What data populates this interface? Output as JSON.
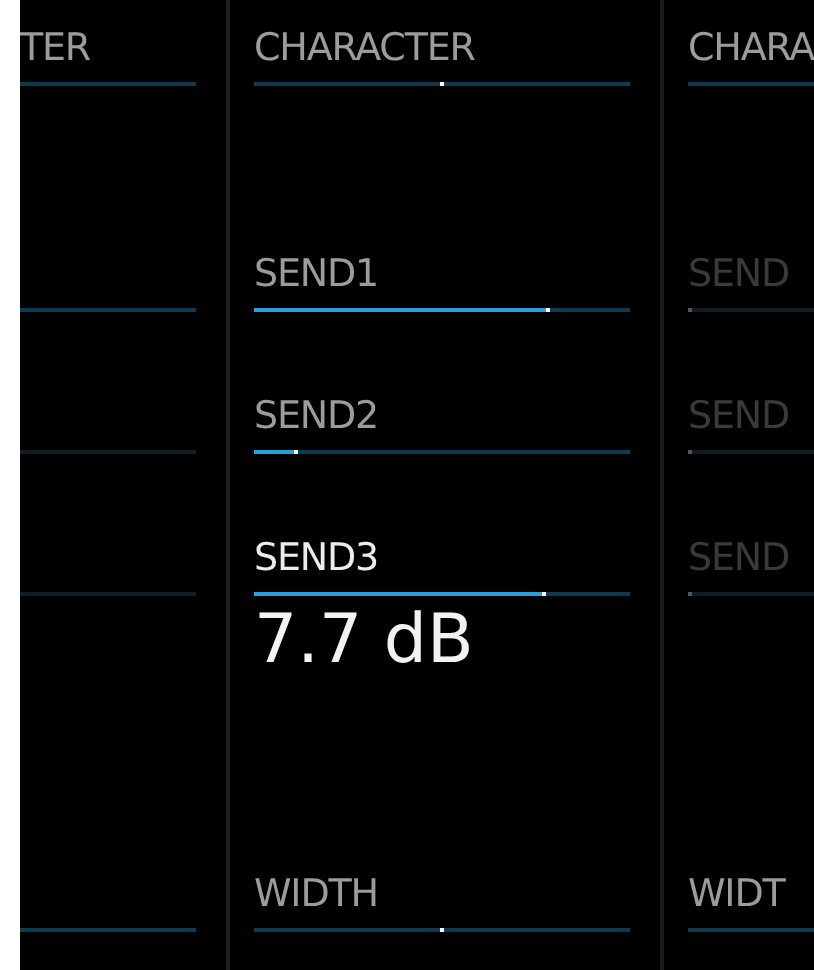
{
  "columns": [
    {
      "params": [
        {
          "label": "TER",
          "disabled": false
        },
        {
          "disabled": false
        },
        {
          "disabled": true
        },
        {
          "disabled": true
        },
        {
          "disabled": false
        }
      ]
    },
    {
      "params": [
        {
          "label": "CHARACTER",
          "kind": "bipolar",
          "level": 0.5,
          "selected": false,
          "disabled": false
        },
        {
          "label": "SEND1",
          "kind": "unipolar",
          "level": 0.78,
          "selected": false,
          "disabled": false
        },
        {
          "label": "SEND2",
          "kind": "unipolar",
          "level": 0.11,
          "selected": false,
          "disabled": false
        },
        {
          "label": "SEND3",
          "kind": "unipolar",
          "level": 0.77,
          "selected": true,
          "disabled": false,
          "readout": "7.7 dB"
        },
        {
          "label": "WIDTH",
          "kind": "bipolar",
          "level": 0.5,
          "selected": false,
          "disabled": false
        }
      ]
    },
    {
      "params": [
        {
          "label": "CHARA",
          "disabled": false
        },
        {
          "label": "SEND",
          "kind": "unipolar",
          "level": 0,
          "disabled": true
        },
        {
          "label": "SEND",
          "kind": "unipolar",
          "level": 0,
          "disabled": true
        },
        {
          "label": "SEND",
          "kind": "unipolar",
          "level": 0,
          "disabled": true
        },
        {
          "label": "WIDT",
          "disabled": false
        }
      ]
    }
  ]
}
